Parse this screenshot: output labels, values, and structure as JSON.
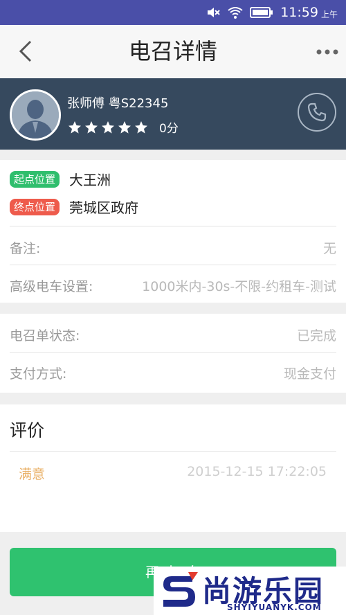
{
  "status_bar": {
    "time": "11:59",
    "ampm": "上午",
    "icons": [
      "mute-icon",
      "wifi-icon",
      "battery-icon"
    ]
  },
  "header": {
    "title": "电召详情",
    "icons": [
      "back-arrow-icon",
      "more-icon"
    ]
  },
  "driver": {
    "name_plate": "张师傅   粤S22345",
    "rating_stars": 5,
    "score": "0分",
    "icons": [
      "avatar-icon",
      "star-icon",
      "phone-icon"
    ],
    "colors": {
      "panel_bg": "#36495e"
    }
  },
  "route": {
    "start_tag": "起点位置",
    "start_value": "大王洲",
    "end_tag": "终点位置",
    "end_value": "莞城区政府"
  },
  "details": {
    "remark_label": "备注:",
    "remark_value": "无",
    "advanced_label": "高级电车设置:",
    "advanced_value": "1000米内-30s-不限-约租车-测试"
  },
  "order": {
    "status_label": "电召单状态:",
    "status_value": "已完成",
    "payment_label": "支付方式:",
    "payment_value": "现金支付"
  },
  "review": {
    "title": "评价",
    "level": "满意",
    "time": "2015-12-15 17:22:05"
  },
  "action": {
    "button_label": "再叫一车",
    "colors": {
      "button_bg": "#2fc26f"
    }
  },
  "watermark": {
    "text": "尚游乐园",
    "sub": "SHYIYUANYK.COM"
  }
}
